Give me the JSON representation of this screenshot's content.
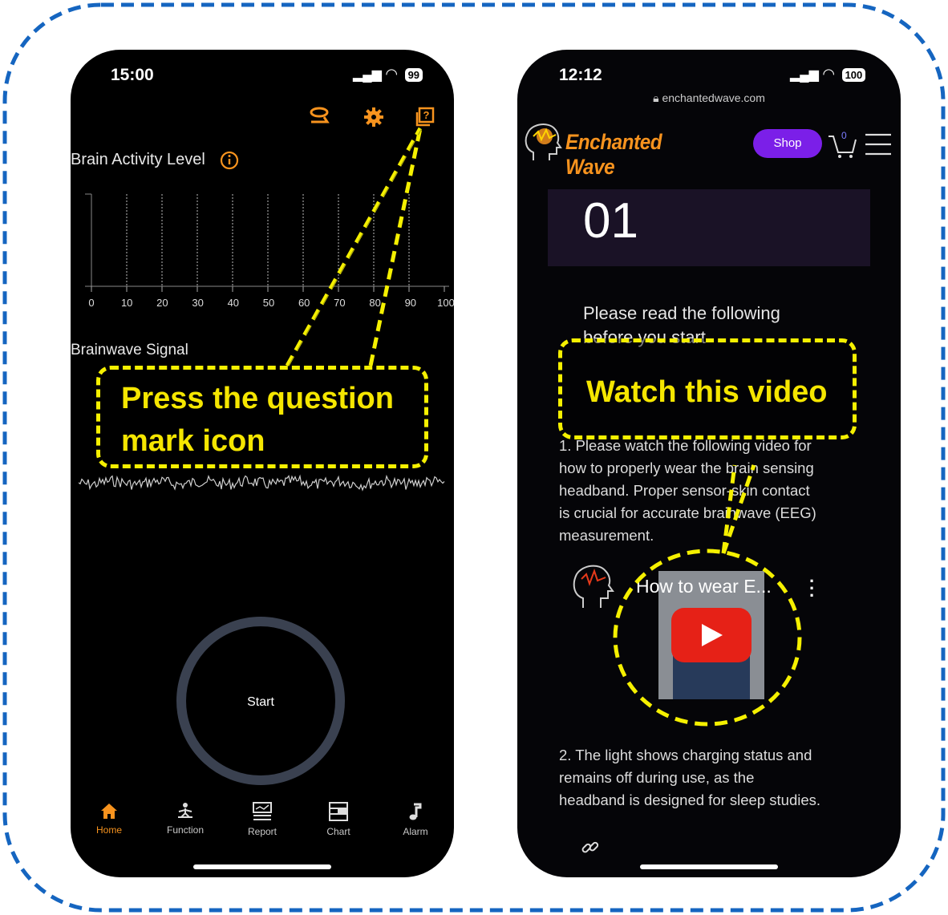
{
  "left_phone": {
    "status": {
      "time": "15:00",
      "battery": "99"
    },
    "brain_activity": {
      "title": "Brain Activity Level",
      "axis_ticks": [
        "0",
        "10",
        "20",
        "30",
        "40",
        "50",
        "60",
        "70",
        "80",
        "90",
        "100"
      ]
    },
    "signal": {
      "title": "Brainwave Signal"
    },
    "start_label": "Start",
    "nav": [
      {
        "label": "Home",
        "active": true
      },
      {
        "label": "Function",
        "active": false
      },
      {
        "label": "Report",
        "active": false
      },
      {
        "label": "Chart",
        "active": false
      },
      {
        "label": "Alarm",
        "active": false
      }
    ],
    "callout": {
      "line1": "Press the question",
      "line2": "mark icon"
    }
  },
  "right_phone": {
    "status": {
      "time": "12:12",
      "battery": "100"
    },
    "url": "enchantedwave.com",
    "brand": "Enchanted Wave",
    "shop_label": "Shop",
    "cart_count": "0",
    "step_number": "01",
    "intro_line1": "Please read the following",
    "intro_line2": "before you start",
    "para1": [
      "1. Please watch the following video for",
      "how to properly wear the brain sensing",
      "headband. Proper sensor-skin contact",
      "is crucial for accurate brainwave (EEG)",
      "measurement."
    ],
    "video_title": "How to wear E...",
    "para2": [
      "2. The light shows charging status and",
      "remains off during use, as the",
      "headband is designed for sleep studies."
    ],
    "callout": "Watch this video"
  },
  "colors": {
    "accent_orange": "#f7931e",
    "callout_yellow": "#f5f000",
    "frame_blue": "#1565c0",
    "shop_purple": "#7b1fe8",
    "youtube_red": "#e62117"
  }
}
